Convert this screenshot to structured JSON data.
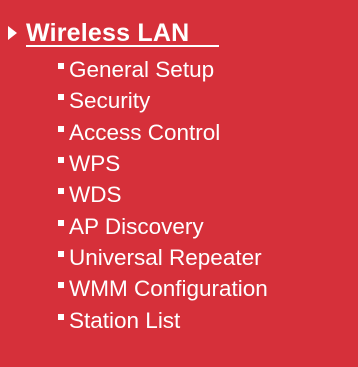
{
  "colors": {
    "background": "#d6303a",
    "text": "#ffffff"
  },
  "menu": {
    "header": {
      "label": "Wireless LAN",
      "icon": "arrow-right-icon"
    },
    "items": [
      {
        "label": "General Setup",
        "icon": "bullet-icon"
      },
      {
        "label": "Security",
        "icon": "bullet-icon"
      },
      {
        "label": "Access Control",
        "icon": "bullet-icon"
      },
      {
        "label": "WPS",
        "icon": "bullet-icon"
      },
      {
        "label": "WDS",
        "icon": "bullet-icon"
      },
      {
        "label": "AP Discovery",
        "icon": "bullet-icon"
      },
      {
        "label": "Universal Repeater",
        "icon": "bullet-icon"
      },
      {
        "label": "WMM Configuration",
        "icon": "bullet-icon"
      },
      {
        "label": "Station List",
        "icon": "bullet-icon"
      }
    ]
  }
}
